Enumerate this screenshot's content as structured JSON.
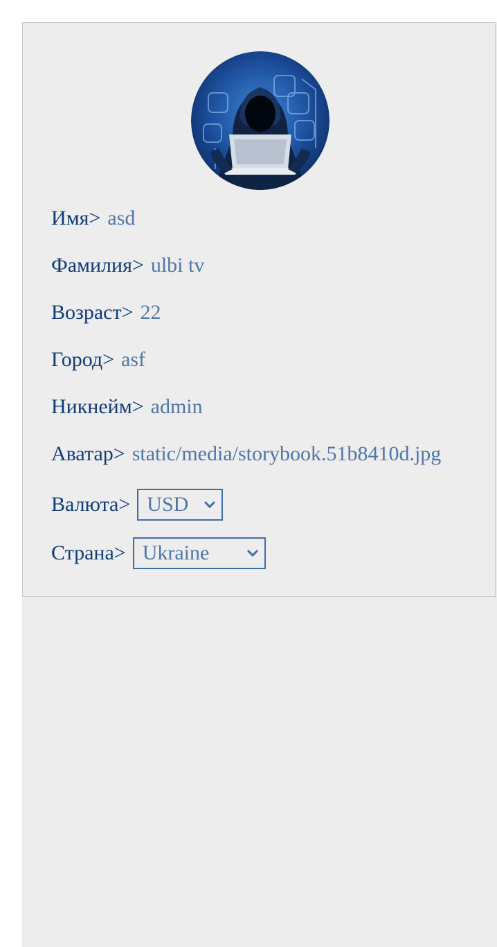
{
  "profile": {
    "avatar_icon": "hacker-avatar",
    "fields": {
      "first_name": {
        "label": "Имя>",
        "value": "asd"
      },
      "last_name": {
        "label": "Фамилия>",
        "value": "ulbi tv"
      },
      "age": {
        "label": "Возраст>",
        "value": "22"
      },
      "city": {
        "label": "Город>",
        "value": "asf"
      },
      "username": {
        "label": "Никнейм>",
        "value": "admin"
      },
      "avatar": {
        "label": "Аватар>",
        "value": "static/media/storybook.51b8410d.jpg"
      }
    },
    "currency": {
      "label": "Валюта>",
      "selected": "USD"
    },
    "country": {
      "label": "Страна>",
      "selected": "Ukraine"
    }
  },
  "colors": {
    "label": "#0f3b78",
    "value": "#4f76a7",
    "background": "#ededee",
    "select_border": "#3f6da6"
  }
}
